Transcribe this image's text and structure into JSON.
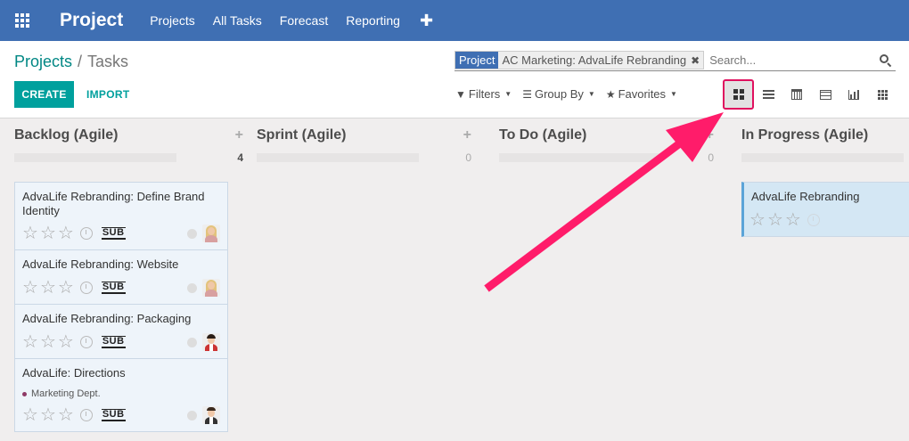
{
  "navbar": {
    "brand": "Project",
    "menu": [
      "Projects",
      "All Tasks",
      "Forecast",
      "Reporting"
    ],
    "plus": "✚"
  },
  "breadcrumb": {
    "parent": "Projects",
    "separator": "/",
    "current": "Tasks"
  },
  "buttons": {
    "create": "CREATE",
    "import": "IMPORT"
  },
  "search": {
    "facet_label": "Project",
    "facet_value": "AC Marketing: AdvaLife Rebranding",
    "facet_remove": "✖",
    "placeholder": "Search..."
  },
  "filters": {
    "filters_label": "Filters",
    "group_by_label": "Group By",
    "favorites_label": "Favorites"
  },
  "views": [
    "kanban",
    "list",
    "calendar",
    "table",
    "graph",
    "pivot"
  ],
  "active_view": "kanban",
  "columns": [
    {
      "title": "Backlog (Agile)",
      "plus": "+",
      "count": "4"
    },
    {
      "title": "Sprint (Agile)",
      "plus": "+",
      "count": "0"
    },
    {
      "title": "To Do (Agile)",
      "plus": "+",
      "count": "0"
    },
    {
      "title": "In Progress (Agile)"
    }
  ],
  "cards": [
    {
      "title": "AdvaLife Rebranding: Define Brand Identity",
      "badge": "SUB",
      "stars": "☆",
      "avatar": "blonde-woman"
    },
    {
      "title": "AdvaLife Rebranding: Website",
      "badge": "SUB",
      "stars": "☆",
      "avatar": "blonde-woman"
    },
    {
      "title": "AdvaLife Rebranding: Packaging",
      "badge": "SUB",
      "stars": "☆",
      "avatar": "dark-haired-man"
    },
    {
      "title": "AdvaLife: Directions",
      "tag": "Marketing Dept.",
      "badge": "SUB",
      "stars": "☆",
      "avatar": "man-in-suit"
    },
    {
      "title": "AdvaLife Rebranding",
      "stars": "☆"
    }
  ],
  "colors": {
    "navbar": "#3f6fb3",
    "primary": "#00a09d",
    "highlight": "#e0115f",
    "tag": "#8e3a66"
  }
}
